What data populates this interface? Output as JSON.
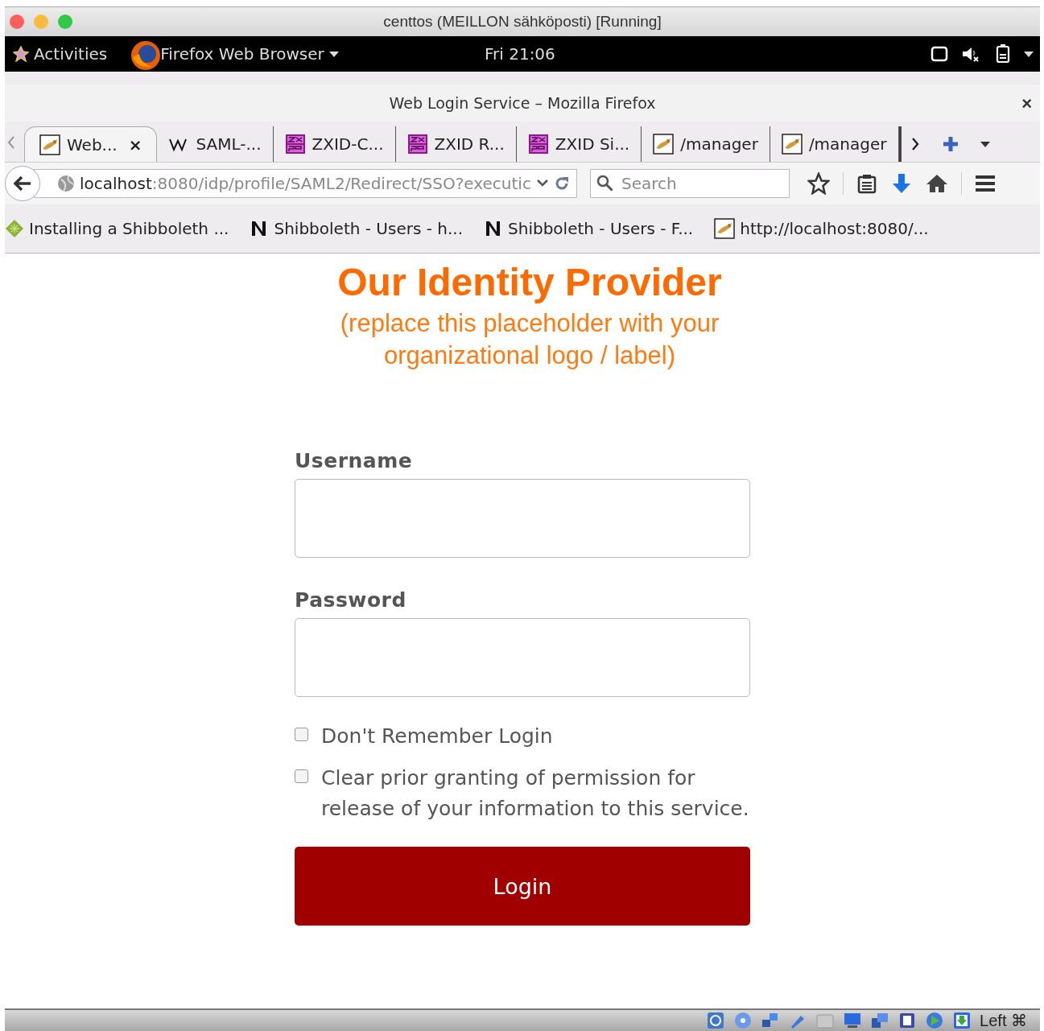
{
  "vm_window": {
    "title": "centtos (MEILLON sähköposti) [Running]"
  },
  "top_bar": {
    "activities": "Activities",
    "app_menu": "Firefox Web Browser",
    "clock": "Fri 21:06"
  },
  "browser": {
    "title": "Web Login Service – Mozilla Firefox",
    "close": "×",
    "tabs": [
      {
        "label": "Web...",
        "kind": "tomcat",
        "selected": true,
        "close": "×"
      },
      {
        "label": "SAML-...",
        "kind": "wiki",
        "selected": false
      },
      {
        "label": "ZXID-C...",
        "kind": "zxsp",
        "selected": false
      },
      {
        "label": "ZXID R...",
        "kind": "zxsp",
        "selected": false
      },
      {
        "label": "ZXID Si...",
        "kind": "zxsp",
        "selected": false
      },
      {
        "label": "/manager",
        "kind": "tomcat",
        "selected": false
      },
      {
        "label": "/manager",
        "kind": "tomcat",
        "selected": false
      }
    ],
    "url": {
      "host": "localhost",
      "rest": ":8080/idp/profile/SAML2/Redirect/SSO?executic"
    },
    "search": {
      "placeholder": "Search"
    },
    "bookmarks": [
      {
        "label": "Installing a Shibboleth ...",
        "kind": "diamond"
      },
      {
        "label": "Shibboleth - Users - h...",
        "kind": "nabble"
      },
      {
        "label": "Shibboleth - Users - F...",
        "kind": "nabble"
      },
      {
        "label": "http://localhost:8080/...",
        "kind": "tomcat"
      }
    ]
  },
  "page": {
    "heading": "Our Identity Provider",
    "subheading": "(replace this placeholder with your organizational logo / label)",
    "fields": [
      {
        "label": "Username"
      },
      {
        "label": "Password"
      }
    ],
    "checkboxes": [
      {
        "label": "Don't Remember Login",
        "checked": false
      },
      {
        "label": "Clear prior granting of permission for release of your information to this service.",
        "checked": false
      }
    ],
    "login_button": "Login"
  },
  "status_bar": {
    "host_key": "Left ⌘"
  }
}
